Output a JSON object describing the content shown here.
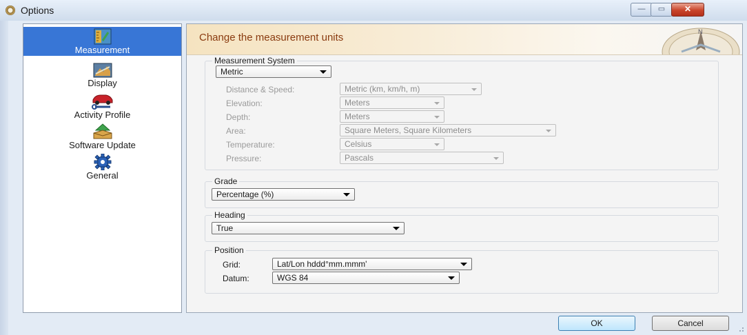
{
  "window": {
    "title": "Options",
    "minimize_icon": "minimize-icon",
    "maximize_icon": "maximize-icon",
    "close_icon": "close-icon",
    "minimize_glyph": "—",
    "maximize_glyph": "▭",
    "close_glyph": "✕"
  },
  "nav": {
    "items": [
      {
        "label": "Measurement",
        "icon": "ruler-map-icon",
        "selected": true
      },
      {
        "label": "Display",
        "icon": "display-map-icon",
        "selected": false
      },
      {
        "label": "Activity Profile",
        "icon": "car-wrench-icon",
        "selected": false
      },
      {
        "label": "Software Update",
        "icon": "software-update-icon",
        "selected": false
      },
      {
        "label": "General",
        "icon": "gear-icon",
        "selected": false
      }
    ]
  },
  "header": {
    "title": "Change the measurement units",
    "compass_label": "N"
  },
  "measurement_system": {
    "legend": "Measurement System",
    "value": "Metric",
    "fields": [
      {
        "label": "Distance & Speed:",
        "value": "Metric (km, km/h, m)"
      },
      {
        "label": "Elevation:",
        "value": "Meters"
      },
      {
        "label": "Depth:",
        "value": "Meters"
      },
      {
        "label": "Area:",
        "value": "Square Meters, Square Kilometers"
      },
      {
        "label": "Temperature:",
        "value": "Celsius"
      },
      {
        "label": "Pressure:",
        "value": "Pascals"
      }
    ]
  },
  "grade": {
    "legend": "Grade",
    "value": "Percentage (%)"
  },
  "heading": {
    "legend": "Heading",
    "value": "True"
  },
  "position": {
    "legend": "Position",
    "grid_label": "Grid:",
    "grid_value": "Lat/Lon hddd°mm.mmm'",
    "datum_label": "Datum:",
    "datum_value": "WGS 84"
  },
  "buttons": {
    "ok": "OK",
    "cancel": "Cancel"
  },
  "colors": {
    "selected_nav": "#3876d6",
    "header_title": "#8a3b10",
    "close_button": "#c9452b"
  }
}
